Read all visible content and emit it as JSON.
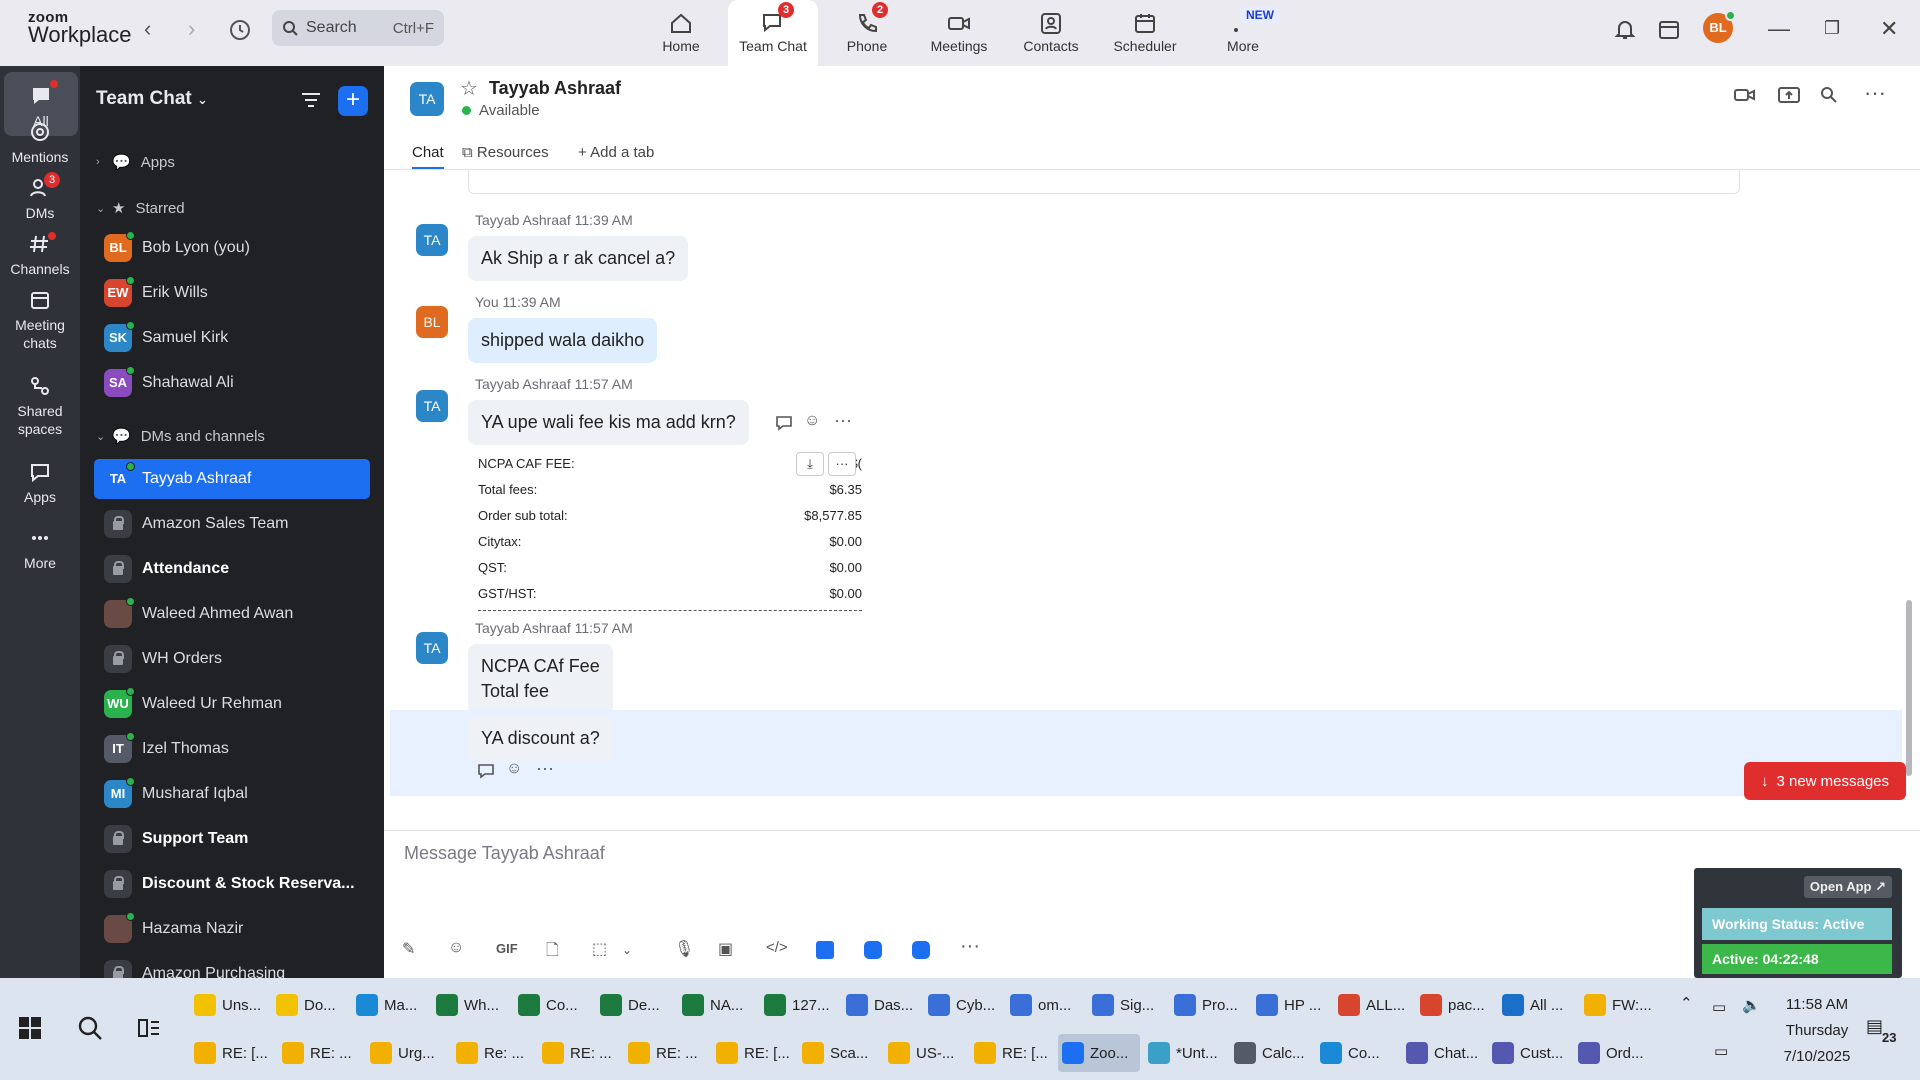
{
  "app": {
    "logo_top": "zoom",
    "logo_bottom": "Workplace",
    "search_placeholder": "Search",
    "search_shortcut": "Ctrl+F"
  },
  "nav_tabs": [
    {
      "label": "Home",
      "icon": "home-icon",
      "badge": ""
    },
    {
      "label": "Team Chat",
      "icon": "chat-icon",
      "badge": "3"
    },
    {
      "label": "Phone",
      "icon": "phone-icon",
      "badge": "2"
    },
    {
      "label": "Meetings",
      "icon": "video-icon",
      "badge": ""
    },
    {
      "label": "Contacts",
      "icon": "contacts-icon",
      "badge": ""
    },
    {
      "label": "Scheduler",
      "icon": "calendar-icon",
      "badge": ""
    },
    {
      "label": "More",
      "icon": "more-icon",
      "badge": "NEW"
    }
  ],
  "user_avatar": "BL",
  "rail": [
    {
      "label": "All",
      "icon": "chat-bubble-icon"
    },
    {
      "label": "Mentions",
      "icon": "at-icon"
    },
    {
      "label": "DMs",
      "icon": "people-icon",
      "badge": "3"
    },
    {
      "label": "Channels",
      "icon": "hash-icon"
    },
    {
      "label": "Meeting chats",
      "icon": "calendar-icon"
    },
    {
      "label": "Shared spaces",
      "icon": "share-icon"
    },
    {
      "label": "Apps",
      "icon": "apps-icon"
    },
    {
      "label": "More",
      "icon": "ellipsis-icon"
    }
  ],
  "sidebar": {
    "title": "Team Chat",
    "sections": {
      "apps": "Apps",
      "starred": "Starred",
      "dms": "DMs and channels"
    },
    "starred": [
      {
        "initials": "BL",
        "name": "Bob Lyon (you)",
        "color": "#e06a20"
      },
      {
        "initials": "EW",
        "name": "Erik Wills",
        "color": "#d8452e"
      },
      {
        "initials": "SK",
        "name": "Samuel Kirk",
        "color": "#2b87c8"
      },
      {
        "initials": "SA",
        "name": "Shahawal Ali",
        "color": "#8a4bbf"
      }
    ],
    "dms": [
      {
        "initials": "TA",
        "name": "Tayyab Ashraaf",
        "color": "#2b87c8",
        "type": "person",
        "selected": true
      },
      {
        "initials": "",
        "name": "Amazon Sales Team",
        "type": "lock"
      },
      {
        "initials": "",
        "name": "Attendance",
        "type": "lock",
        "bold": true
      },
      {
        "initials": "",
        "name": "Waleed Ahmed Awan",
        "type": "photo"
      },
      {
        "initials": "",
        "name": "WH Orders",
        "type": "lock"
      },
      {
        "initials": "WU",
        "name": "Waleed Ur Rehman",
        "color": "#2bb24c",
        "type": "person"
      },
      {
        "initials": "IT",
        "name": "Izel Thomas",
        "color": "#555b66",
        "type": "person"
      },
      {
        "initials": "MI",
        "name": "Musharaf Iqbal",
        "color": "#2b87c8",
        "type": "person"
      },
      {
        "initials": "",
        "name": "Support Team",
        "type": "lock",
        "bold": true
      },
      {
        "initials": "",
        "name": "Discount & Stock Reserva...",
        "type": "lock",
        "bold": true
      },
      {
        "initials": "",
        "name": "Hazama Nazir",
        "type": "photo"
      },
      {
        "initials": "",
        "name": "Amazon Purchasing",
        "type": "lock"
      }
    ]
  },
  "chat": {
    "initials": "TA",
    "name": "Tayyab Ashraaf",
    "status": "Available",
    "tabs": [
      "Chat",
      "Resources",
      "Add a tab"
    ],
    "messages": [
      {
        "sender": "Tayyab Ashraaf",
        "time": "11:39 AM",
        "text": "Ak Ship a r ak cancel a?"
      },
      {
        "sender": "You",
        "time": "11:39 AM",
        "text": "shipped wala daikho"
      },
      {
        "sender": "Tayyab Ashraaf",
        "time": "11:57 AM",
        "text": "YA upe wali fee kis ma add krn?"
      },
      {
        "sender": "Tayyab Ashraaf",
        "time": "11:57 AM",
        "text_line1": "NCPA CAf Fee",
        "text_line2": "Total fee"
      },
      {
        "text": "YA discount a?"
      }
    ],
    "fee_table": [
      {
        "label": "NCPA CAF FEE:",
        "value": "$("
      },
      {
        "label": "Total fees:",
        "value": "$6.35"
      },
      {
        "label": "Order sub total:",
        "value": "$8,577.85"
      },
      {
        "label": "Citytax:",
        "value": "$0.00"
      },
      {
        "label": "QST:",
        "value": "$0.00"
      },
      {
        "label": "GST/HST:",
        "value": "$0.00"
      }
    ],
    "new_messages": "3 new messages",
    "composer_placeholder": "Message Tayyab Ashraaf",
    "gif_label": "GIF"
  },
  "widget": {
    "open_app": "Open App ↗",
    "working_status": "Working Status: Active",
    "active_timer": "Active: 04:22:48"
  },
  "taskbar": {
    "row1": [
      {
        "label": "Uns...",
        "color": "#f2c200"
      },
      {
        "label": "Do...",
        "color": "#f2c200"
      },
      {
        "label": "Ma...",
        "color": "#1b8ad6"
      },
      {
        "label": "Wh...",
        "color": "#1d7a3e"
      },
      {
        "label": "Co...",
        "color": "#1d7a3e"
      },
      {
        "label": "De...",
        "color": "#1d7a3e"
      },
      {
        "label": "NA...",
        "color": "#1d7a3e"
      },
      {
        "label": "127...",
        "color": "#1d7a3e"
      },
      {
        "label": "Das...",
        "color": "#3a6fd8"
      },
      {
        "label": "Cyb...",
        "color": "#3a6fd8"
      },
      {
        "label": "om...",
        "color": "#3a6fd8"
      },
      {
        "label": "Sig...",
        "color": "#3a6fd8"
      },
      {
        "label": "Pro...",
        "color": "#3a6fd8"
      },
      {
        "label": "HP ...",
        "color": "#3a6fd8"
      },
      {
        "label": "ALL...",
        "color": "#d8452e"
      },
      {
        "label": "pac...",
        "color": "#d8452e"
      },
      {
        "label": "All ...",
        "color": "#1b6fc8"
      },
      {
        "label": "FW:...",
        "color": "#f2b000"
      }
    ],
    "row2": [
      {
        "label": "RE: [...",
        "color": "#f2b000"
      },
      {
        "label": "RE: ...",
        "color": "#f2b000"
      },
      {
        "label": "Urg...",
        "color": "#f2b000"
      },
      {
        "label": "Re: ...",
        "color": "#f2b000"
      },
      {
        "label": "RE: ...",
        "color": "#f2b000"
      },
      {
        "label": "RE: ...",
        "color": "#f2b000"
      },
      {
        "label": "RE: [...",
        "color": "#f2b000"
      },
      {
        "label": "Sca...",
        "color": "#f2b000"
      },
      {
        "label": "US-...",
        "color": "#f2b000"
      },
      {
        "label": "RE: [...",
        "color": "#f2b000"
      },
      {
        "label": "Zoo...",
        "color": "#1d6ff2"
      },
      {
        "label": "*Unt...",
        "color": "#3aa0c8"
      },
      {
        "label": "Calc...",
        "color": "#555b66"
      },
      {
        "label": "Co...",
        "color": "#1b8ad6"
      },
      {
        "label": "Chat...",
        "color": "#5558af"
      },
      {
        "label": "Cust...",
        "color": "#5558af"
      },
      {
        "label": "Ord...",
        "color": "#5558af"
      }
    ],
    "time": "11:58 AM",
    "day": "Thursday",
    "date": "7/10/2025",
    "notif_count": "23"
  }
}
